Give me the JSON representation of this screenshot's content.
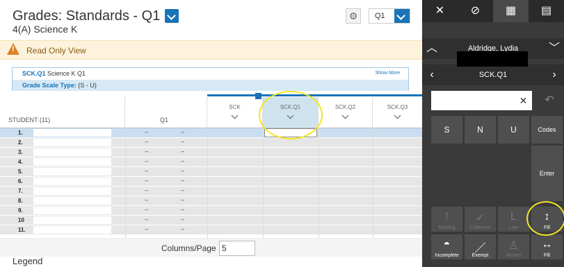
{
  "header": {
    "title": "Grades: Standards - Q1",
    "subtitle": "4(A) Science K",
    "term": "Q1"
  },
  "banner": {
    "text": "Read Only View"
  },
  "info": {
    "code": "SCK.Q1",
    "desc": "Science K Q1",
    "show_more": "Show More",
    "scale_label": "Grade Scale Type:",
    "scale_value": "(S - U)"
  },
  "grid": {
    "student_header": "STUDENT (11)",
    "q1_header": "Q1",
    "columns": [
      "SCK",
      "SCK.Q1",
      "SCK.Q2",
      "SCK.Q3"
    ],
    "rows": [
      {
        "num": "1.",
        "d1": "--",
        "d2": "--"
      },
      {
        "num": "2.",
        "d1": "--",
        "d2": "--"
      },
      {
        "num": "3.",
        "d1": "--",
        "d2": "--"
      },
      {
        "num": "4.",
        "d1": "--",
        "d2": "--"
      },
      {
        "num": "5.",
        "d1": "--",
        "d2": "--"
      },
      {
        "num": "6.",
        "d1": "--",
        "d2": "--"
      },
      {
        "num": "7.",
        "d1": "--",
        "d2": "--"
      },
      {
        "num": "8.",
        "d1": "--",
        "d2": "--"
      },
      {
        "num": "9.",
        "d1": "--",
        "d2": "--"
      },
      {
        "num": "10",
        "d1": "--",
        "d2": "--"
      },
      {
        "num": "11.",
        "d1": "--",
        "d2": "--"
      }
    ]
  },
  "footer": {
    "columns_label": "Columns/Page",
    "columns_value": "5",
    "legend": "Legend"
  },
  "panel": {
    "toolbar": {
      "close": "✕",
      "chart": "⊘",
      "grid": "▦",
      "comment": "▤"
    },
    "student_name": "Aldridge, Lydia",
    "assignment": "SCK.Q1",
    "clear": "✕",
    "undo": "↶",
    "keys": {
      "s": "S",
      "n": "N",
      "u": "U",
      "codes": "Codes",
      "enter": "Enter"
    },
    "flags": {
      "missing": "Missing",
      "collected": "Collected",
      "late": "Late",
      "fill_v": "Fill",
      "incomplete": "Incomplete",
      "exempt": "Exempt",
      "absent": "Absent",
      "fill_h": "Fill"
    }
  }
}
